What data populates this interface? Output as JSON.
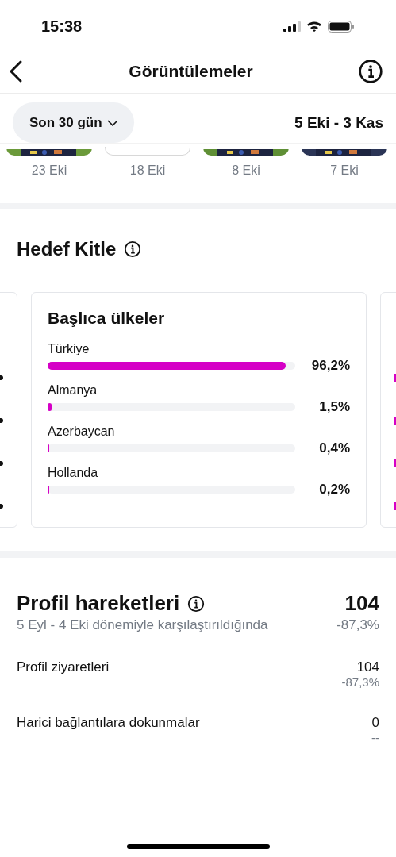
{
  "status_bar": {
    "time": "15:38"
  },
  "header": {
    "title": "Görüntülemeler"
  },
  "filter": {
    "range": "Son 30 gün",
    "dates": "5 Eki - 3 Kas"
  },
  "posts": [
    {
      "date": "23 Eki"
    },
    {
      "date": "18 Eki"
    },
    {
      "date": "8 Eki"
    },
    {
      "date": "7 Eki"
    }
  ],
  "audience": {
    "title": "Hedef Kitle",
    "card": {
      "title": "Başlıca ülkeler",
      "rows": [
        {
          "name": "Türkiye",
          "level": 0.962,
          "value": "96,2%"
        },
        {
          "name": "Almanya",
          "level": 0.015,
          "value": "1,5%"
        },
        {
          "name": "Azerbaycan",
          "level": 0.004,
          "value": "0,4%"
        },
        {
          "name": "Hollanda",
          "level": 0.002,
          "value": "0,2%"
        }
      ]
    }
  },
  "profile_activity": {
    "title": "Profil hareketleri",
    "total": "104",
    "comparison": "5 Eyl - 4 Eki dönemiyle karşılaştırıldığında",
    "change": "-87,3%",
    "rows": [
      {
        "label": "Profil ziyaretleri",
        "value": "104",
        "change": "-87,3%"
      },
      {
        "label": "Harici bağlantılara dokunmalar",
        "value": "0",
        "change": "--"
      }
    ]
  }
}
